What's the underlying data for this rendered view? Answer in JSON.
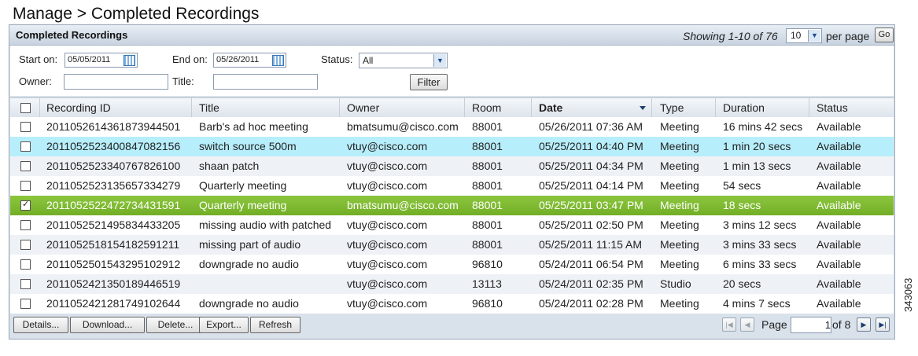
{
  "page_title": "Manage > Completed Recordings",
  "panel": {
    "title": "Completed Recordings",
    "showing": "Showing 1-10 of 76",
    "per_page_value": "10",
    "per_page_label": "per page",
    "go_label": "Go"
  },
  "filters": {
    "start_label": "Start on:",
    "start_value": "05/05/2011",
    "end_label": "End on:",
    "end_value": "05/26/2011",
    "status_label": "Status:",
    "status_value": "All",
    "owner_label": "Owner:",
    "owner_value": "",
    "title_label": "Title:",
    "title_value": "",
    "filter_button": "Filter"
  },
  "columns": [
    "Recording ID",
    "Title",
    "Owner",
    "Room",
    "Date",
    "Type",
    "Duration",
    "Status"
  ],
  "sorted_column": "Date",
  "rows": [
    {
      "id": "201105261436187394450​1",
      "title": "Barb's ad hoc meeting",
      "owner": "bmatsumu@cisco.com",
      "room": "88001",
      "date": "05/26/2011 07:36 AM",
      "type": "Meeting",
      "duration": "16 mins 42 secs",
      "status": "Available",
      "checked": false,
      "state": "even"
    },
    {
      "id": "20110525234008470821​56",
      "title": "switch source 500m",
      "owner": "vtuy@cisco.com",
      "room": "88001",
      "date": "05/25/2011 04:40 PM",
      "type": "Meeting",
      "duration": "1 min 20 secs",
      "status": "Available",
      "checked": false,
      "state": "hover"
    },
    {
      "id": "20110525233407678261​00",
      "title": "shaan patch",
      "owner": "vtuy@cisco.com",
      "room": "88001",
      "date": "05/25/2011 04:34 PM",
      "type": "Meeting",
      "duration": "1 min 13 secs",
      "status": "Available",
      "checked": false,
      "state": "odd"
    },
    {
      "id": "20110525231356573342​79",
      "title": "Quarterly meeting",
      "owner": "vtuy@cisco.com",
      "room": "88001",
      "date": "05/25/2011 04:14 PM",
      "type": "Meeting",
      "duration": "54 secs",
      "status": "Available",
      "checked": false,
      "state": "even"
    },
    {
      "id": "20110525224727344315​91",
      "title": "Quarterly meeting",
      "owner": "bmatsumu@cisco.com",
      "room": "88001",
      "date": "05/25/2011 03:47 PM",
      "type": "Meeting",
      "duration": "18 secs",
      "status": "Available",
      "checked": true,
      "state": "selected"
    },
    {
      "id": "20110525214958344332​05",
      "title": "missing audio with patched",
      "owner": "vtuy@cisco.com",
      "room": "88001",
      "date": "05/25/2011 02:50 PM",
      "type": "Meeting",
      "duration": "3 mins 12 secs",
      "status": "Available",
      "checked": false,
      "state": "even"
    },
    {
      "id": "20110525181541825912​11",
      "title": "missing part of audio",
      "owner": "vtuy@cisco.com",
      "room": "88001",
      "date": "05/25/2011 11:15 AM",
      "type": "Meeting",
      "duration": "3 mins 33 secs",
      "status": "Available",
      "checked": false,
      "state": "odd"
    },
    {
      "id": "20110525015432951029​12",
      "title": "downgrade no audio",
      "owner": "vtuy@cisco.com",
      "room": "96810",
      "date": "05/24/2011 06:54 PM",
      "type": "Meeting",
      "duration": "6 mins 33 secs",
      "status": "Available",
      "checked": false,
      "state": "even"
    },
    {
      "id": "20110524213501894465​19",
      "title": "",
      "owner": "vtuy@cisco.com",
      "room": "13113",
      "date": "05/24/2011 02:35 PM",
      "type": "Studio",
      "duration": "20 secs",
      "status": "Available",
      "checked": false,
      "state": "odd"
    },
    {
      "id": "20110524212817491026​44",
      "title": "downgrade no audio",
      "owner": "vtuy@cisco.com",
      "room": "96810",
      "date": "05/24/2011 02:28 PM",
      "type": "Meeting",
      "duration": "4 mins 7 secs",
      "status": "Available",
      "checked": false,
      "state": "even"
    }
  ],
  "footer": {
    "buttons": [
      "Details...",
      "Download...",
      "Delete...",
      "Export...",
      "Refresh"
    ],
    "page_label": "Page",
    "page_value": "1",
    "of_label": "of 8"
  },
  "side_id": "343063"
}
